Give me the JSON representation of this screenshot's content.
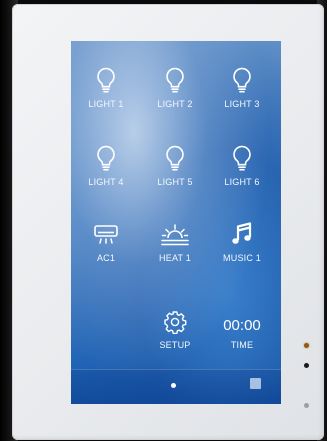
{
  "panel": {
    "tiles": [
      {
        "label": "LIGHT 1",
        "icon": "bulb-icon"
      },
      {
        "label": "LIGHT 2",
        "icon": "bulb-icon"
      },
      {
        "label": "LIGHT 3",
        "icon": "bulb-icon"
      },
      {
        "label": "LIGHT 4",
        "icon": "bulb-icon"
      },
      {
        "label": "LIGHT 5",
        "icon": "bulb-icon"
      },
      {
        "label": "LIGHT 6",
        "icon": "bulb-icon"
      },
      {
        "label": "AC1",
        "icon": "air-conditioner-icon"
      },
      {
        "label": "HEAT 1",
        "icon": "heater-icon"
      },
      {
        "label": "MUSIC 1",
        "icon": "music-note-icon"
      },
      {
        "label": "SETUP",
        "icon": "gear-icon"
      },
      {
        "label": "TIME",
        "value": "00:00"
      }
    ]
  },
  "footer": {
    "page_indicator": "page-dot-icon",
    "corner_button": "square-icon"
  },
  "colors": {
    "screen_blue": "#1f65b8",
    "bezel": "#eceef1"
  }
}
